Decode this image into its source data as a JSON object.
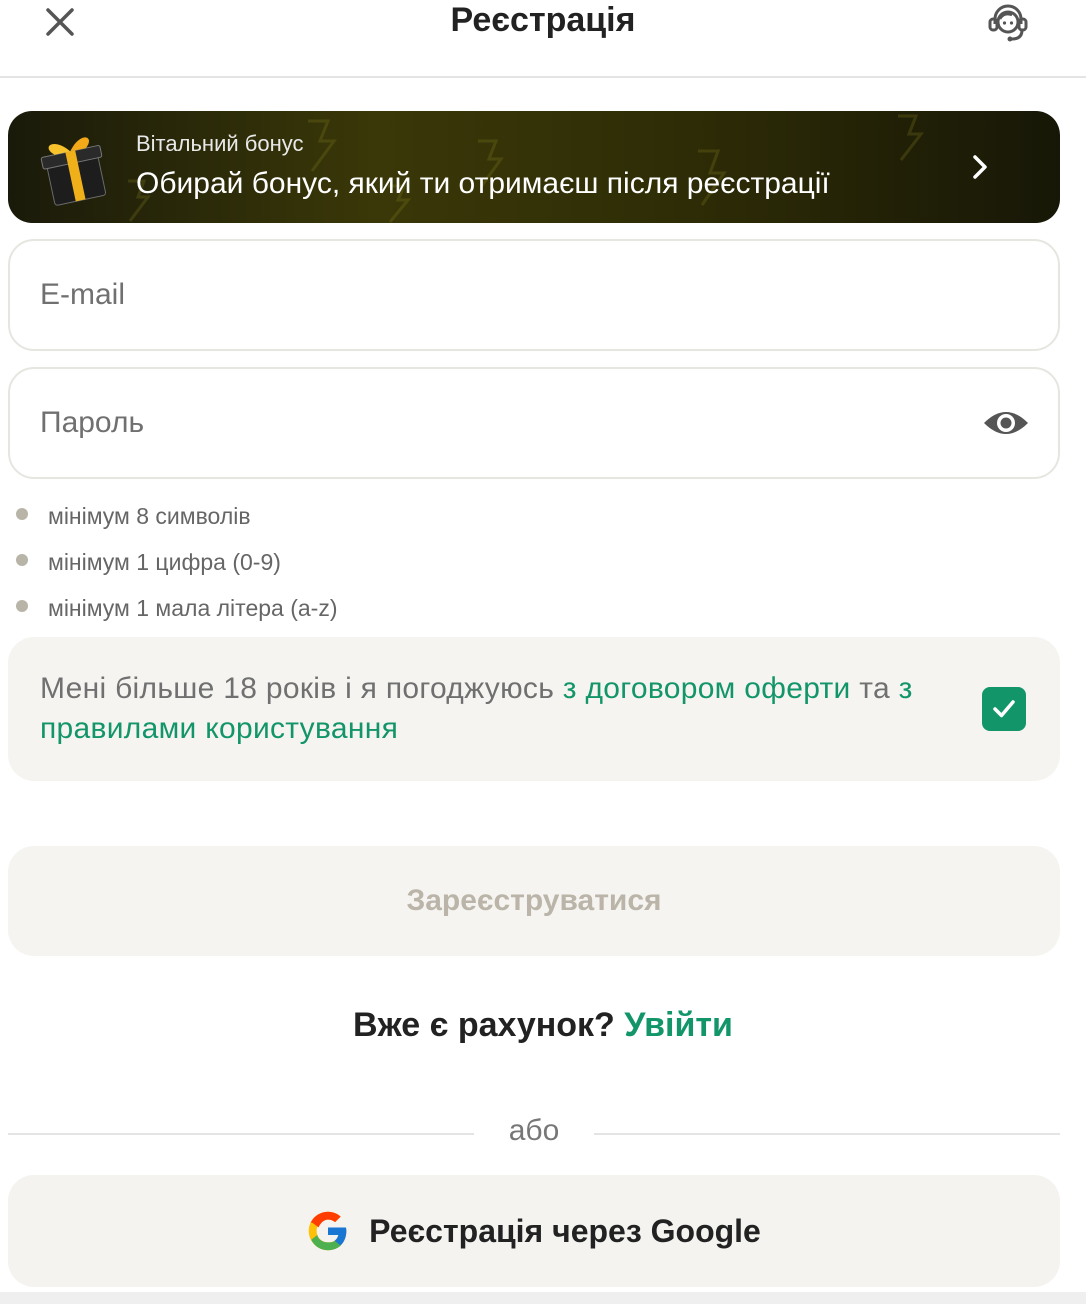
{
  "header": {
    "title": "Реєстрація",
    "close_icon": "close-icon",
    "support_icon": "headset-icon"
  },
  "bonus_banner": {
    "kicker": "Вітальний бонус",
    "headline": "Обирай бонус, який ти отримаєш після реєстрації",
    "icon": "gift-icon",
    "chevron_icon": "chevron-right-icon",
    "background_colors": [
      "#1a1a0a",
      "#3a3808",
      "#171707"
    ]
  },
  "form": {
    "email": {
      "placeholder": "E-mail",
      "value": ""
    },
    "password": {
      "placeholder": "Пароль",
      "value": "",
      "toggle_icon": "eye-icon"
    },
    "password_rules": [
      "мінімум 8 символів",
      "мінімум 1 цифра (0-9)",
      "мінімум 1 мала літера (a-z)"
    ],
    "consent": {
      "text_before": "Мені більше 18 років і я погоджуюсь ",
      "offer_link": "з договором оферти",
      "text_between": " та ",
      "rules_link": "з правилами користування",
      "checked": true
    },
    "submit_label": "Зареєструватися"
  },
  "login": {
    "prompt": "Вже є рахунок?",
    "link": "Увійти"
  },
  "divider_label": "або",
  "google": {
    "label": "Реєстрація через Google",
    "icon": "google-icon"
  },
  "colors": {
    "accent": "#13956a",
    "muted_button_text": "#bab5a8",
    "panel_bg": "#f5f4f1"
  }
}
